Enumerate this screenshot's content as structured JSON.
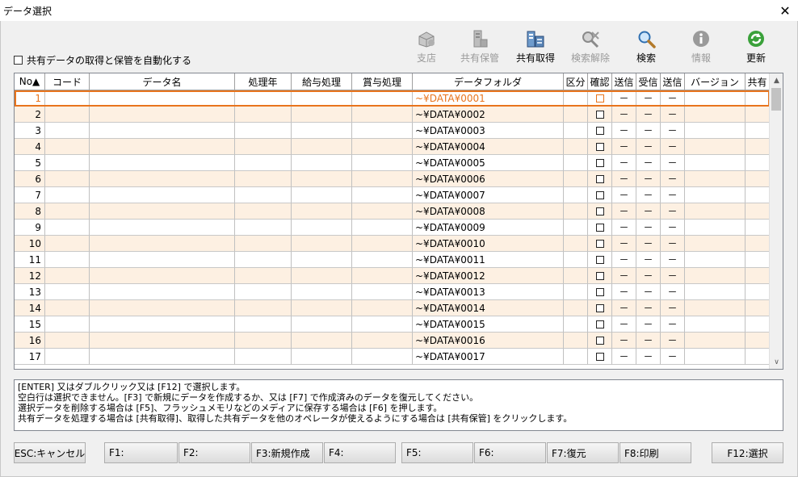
{
  "window": {
    "title": "データ選択",
    "close_glyph": "✕"
  },
  "autosave": {
    "label": "共有データの取得と保管を自動化する",
    "checked": false
  },
  "toolbar": {
    "items": [
      {
        "label": "支店",
        "icon": "branch-icon",
        "enabled": false
      },
      {
        "label": "共有保管",
        "icon": "shared-store-icon",
        "enabled": false
      },
      {
        "label": "共有取得",
        "icon": "shared-get-icon",
        "enabled": true
      },
      {
        "label": "検索解除",
        "icon": "search-clear-icon",
        "enabled": false
      },
      {
        "label": "検索",
        "icon": "search-icon",
        "enabled": true
      },
      {
        "label": "情報",
        "icon": "info-icon",
        "enabled": false
      },
      {
        "label": "更新",
        "icon": "refresh-icon",
        "enabled": true
      }
    ]
  },
  "table": {
    "columns": [
      {
        "key": "no",
        "label": "No▲"
      },
      {
        "key": "code",
        "label": "コード"
      },
      {
        "key": "name",
        "label": "データ名"
      },
      {
        "key": "year",
        "label": "処理年"
      },
      {
        "key": "salary",
        "label": "給与処理"
      },
      {
        "key": "bonus",
        "label": "賞与処理"
      },
      {
        "key": "folder",
        "label": "データフォルダ"
      },
      {
        "key": "kubun",
        "label": "区分"
      },
      {
        "key": "confirm",
        "label": "確認"
      },
      {
        "key": "send1",
        "label": "送信"
      },
      {
        "key": "recv",
        "label": "受信"
      },
      {
        "key": "send2",
        "label": "送信"
      },
      {
        "key": "version",
        "label": "バージョン"
      },
      {
        "key": "shared",
        "label": "共有"
      }
    ],
    "selected_row": 0,
    "dash": "－",
    "rows": [
      {
        "no": "1",
        "folder": "~¥DATA¥0001"
      },
      {
        "no": "2",
        "folder": "~¥DATA¥0002"
      },
      {
        "no": "3",
        "folder": "~¥DATA¥0003"
      },
      {
        "no": "4",
        "folder": "~¥DATA¥0004"
      },
      {
        "no": "5",
        "folder": "~¥DATA¥0005"
      },
      {
        "no": "6",
        "folder": "~¥DATA¥0006"
      },
      {
        "no": "7",
        "folder": "~¥DATA¥0007"
      },
      {
        "no": "8",
        "folder": "~¥DATA¥0008"
      },
      {
        "no": "9",
        "folder": "~¥DATA¥0009"
      },
      {
        "no": "10",
        "folder": "~¥DATA¥0010"
      },
      {
        "no": "11",
        "folder": "~¥DATA¥0011"
      },
      {
        "no": "12",
        "folder": "~¥DATA¥0012"
      },
      {
        "no": "13",
        "folder": "~¥DATA¥0013"
      },
      {
        "no": "14",
        "folder": "~¥DATA¥0014"
      },
      {
        "no": "15",
        "folder": "~¥DATA¥0015"
      },
      {
        "no": "16",
        "folder": "~¥DATA¥0016"
      },
      {
        "no": "17",
        "folder": "~¥DATA¥0017"
      }
    ],
    "scroll": {
      "up": "▲",
      "down": "∨"
    }
  },
  "help": {
    "lines": [
      "[ENTER] 又はダブルクリック又は [F12] で選択します。",
      "空白行は選択できません。[F3] で新規にデータを作成するか、又は [F7] で作成済みのデータを復元してください。",
      "選択データを削除する場合は [F5]、フラッシュメモリなどのメディアに保存する場合は [F6] を押します。",
      "共有データを処理する場合は [共有取得]、取得した共有データを他のオペレータが使えるようにする場合は [共有保管] をクリックします。"
    ]
  },
  "fkeys": [
    {
      "label": "ESC:キャンセル",
      "name": "esc-cancel-button"
    },
    {
      "label": "F1:",
      "name": "f1-button"
    },
    {
      "label": "F2:",
      "name": "f2-button"
    },
    {
      "label": "F3:新規作成",
      "name": "f3-new-button"
    },
    {
      "label": "F4:",
      "name": "f4-button"
    },
    {
      "label": "F5:",
      "name": "f5-button"
    },
    {
      "label": "F6:",
      "name": "f6-button"
    },
    {
      "label": "F7:復元",
      "name": "f7-restore-button"
    },
    {
      "label": "F8:印刷",
      "name": "f8-print-button"
    },
    {
      "label": "F12:選択",
      "name": "f12-select-button"
    }
  ],
  "colors": {
    "accent": "#e8741d",
    "row_alt": "#fdf0e2",
    "disabled_text": "#9a9a9a"
  }
}
